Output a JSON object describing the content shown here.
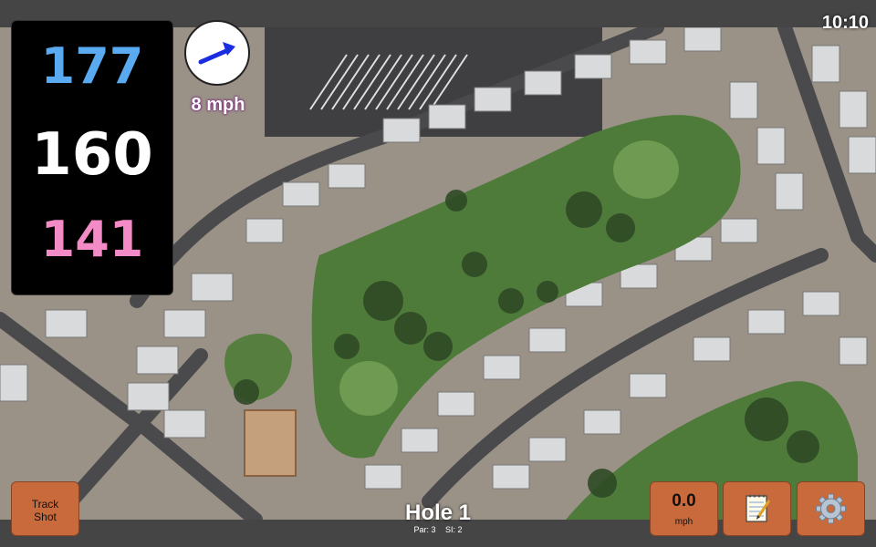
{
  "status": {
    "time": "10:10"
  },
  "yardage": {
    "back": "177",
    "middle": "160",
    "front": "141"
  },
  "wind": {
    "speed_label": "8 mph",
    "arrow_icon": "wind-arrow-icon"
  },
  "hole": {
    "title": "Hole 1",
    "par": "Par: 3",
    "si": "SI: 2"
  },
  "buttons": {
    "track_shot": "Track Shot",
    "speed_value": "0.0",
    "speed_unit": "mph",
    "notes_icon": "notepad-icon",
    "settings_icon": "gear-icon"
  },
  "colors": {
    "accent_button": "#c96a3c",
    "yardage_back": "#5aaaf2",
    "yardage_mid": "#ffffff",
    "yardage_front": "#f28bc6",
    "wind_arrow": "#1a2ee0"
  }
}
